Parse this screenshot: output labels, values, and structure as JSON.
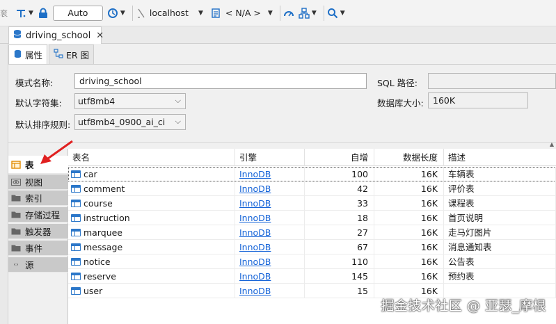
{
  "toolbar": {
    "auto_label": "Auto",
    "connection": "localhost",
    "schema": "< N/A >",
    "partial_left_text": "衮"
  },
  "editor_tab": {
    "title": "driving_school"
  },
  "sub_tabs": [
    {
      "label": "属性"
    },
    {
      "label": "ER 图"
    }
  ],
  "properties": {
    "schema_name_label": "模式名称:",
    "schema_name_value": "driving_school",
    "charset_label": "默认字符集:",
    "charset_value": "utf8mb4",
    "collation_label": "默认排序规则:",
    "collation_value": "utf8mb4_0900_ai_ci",
    "sql_path_label": "SQL 路径:",
    "sql_path_value": "",
    "db_size_label": "数据库大小:",
    "db_size_value": "160K"
  },
  "object_tabs": [
    {
      "label": "表"
    },
    {
      "label": "视图"
    },
    {
      "label": "索引"
    },
    {
      "label": "存储过程"
    },
    {
      "label": "触发器"
    },
    {
      "label": "事件"
    },
    {
      "label": "源"
    }
  ],
  "grid": {
    "columns": [
      "表名",
      "引擎",
      "自增",
      "数据长度",
      "描述"
    ],
    "rows": [
      {
        "name": "car",
        "engine": "InnoDB",
        "auto_inc": "100",
        "data_len": "16K",
        "desc": "车辆表"
      },
      {
        "name": "comment",
        "engine": "InnoDB",
        "auto_inc": "42",
        "data_len": "16K",
        "desc": "评价表"
      },
      {
        "name": "course",
        "engine": "InnoDB",
        "auto_inc": "33",
        "data_len": "16K",
        "desc": "课程表"
      },
      {
        "name": "instruction",
        "engine": "InnoDB",
        "auto_inc": "18",
        "data_len": "16K",
        "desc": "首页说明"
      },
      {
        "name": "marquee",
        "engine": "InnoDB",
        "auto_inc": "27",
        "data_len": "16K",
        "desc": "走马灯图片"
      },
      {
        "name": "message",
        "engine": "InnoDB",
        "auto_inc": "67",
        "data_len": "16K",
        "desc": "消息通知表"
      },
      {
        "name": "notice",
        "engine": "InnoDB",
        "auto_inc": "110",
        "data_len": "16K",
        "desc": "公告表"
      },
      {
        "name": "reserve",
        "engine": "InnoDB",
        "auto_inc": "145",
        "data_len": "16K",
        "desc": "预约表"
      },
      {
        "name": "user",
        "engine": "InnoDB",
        "auto_inc": "15",
        "data_len": "16K",
        "desc": ""
      }
    ]
  },
  "watermark": "掘金技术社区 @ 亚瑟_摩根",
  "colors": {
    "link": "#1463d8",
    "accent_blue": "#2b77c9",
    "arrow_red": "#e02020"
  }
}
